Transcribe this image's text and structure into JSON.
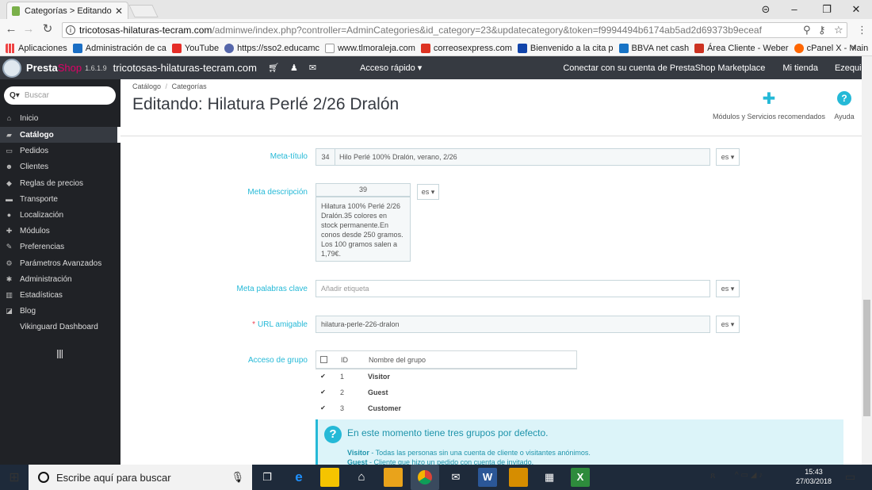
{
  "browser": {
    "tab_title": "Categorías > Editando: H",
    "tab_close": "✕",
    "url_host": "tricotosas-hilaturas-tecram.com",
    "url_path": "/adminwe/index.php?controller=AdminCategories&id_category=23&updatecategory&token=f9994494b6174ab5ad2d69373b9eceaf",
    "window_controls": [
      "⊝",
      "–",
      "❐",
      "✕"
    ],
    "bookmarks": [
      {
        "label": "Aplicaciones",
        "color": "#e44"
      },
      {
        "label": "Administración de ca",
        "color": "#1a6ec4"
      },
      {
        "label": "YouTube",
        "color": "#e52d27"
      },
      {
        "label": "https://sso2.educamc",
        "color": "#56a"
      },
      {
        "label": "www.tlmoraleja.com",
        "color": "#999"
      },
      {
        "label": "correosexpress.com",
        "color": "#d32"
      },
      {
        "label": "Bienvenido a la cita p",
        "color": "#14a"
      },
      {
        "label": "BBVA net cash",
        "color": "#1773c5"
      },
      {
        "label": "Área Cliente - Weber",
        "color": "#c32"
      },
      {
        "label": "cPanel X - Main",
        "color": "#f60"
      }
    ]
  },
  "header": {
    "brand_presta": "Presta",
    "brand_shop": "Shop",
    "version": "1.6.1.9",
    "shop_host": "tricotosas-hilaturas-tecram.com",
    "quick_access": "Acceso rápido ▾",
    "marketplace": "Conectar con su cuenta de PrestaShop Marketplace",
    "my_shop": "Mi tienda",
    "user": "Ezequiel Golderos ▾"
  },
  "sidebar": {
    "search_placeholder": "Buscar",
    "items": [
      {
        "label": "Inicio",
        "icon": "home-icon",
        "glyph": "⌂"
      },
      {
        "label": "Catálogo",
        "icon": "book-icon",
        "glyph": "▰"
      },
      {
        "label": "Pedidos",
        "icon": "card-icon",
        "glyph": "▭"
      },
      {
        "label": "Clientes",
        "icon": "users-icon",
        "glyph": "☻"
      },
      {
        "label": "Reglas de precios",
        "icon": "tags-icon",
        "glyph": "◆"
      },
      {
        "label": "Transporte",
        "icon": "truck-icon",
        "glyph": "▬"
      },
      {
        "label": "Localización",
        "icon": "globe-icon",
        "glyph": "●"
      },
      {
        "label": "Módulos",
        "icon": "puzzle-icon",
        "glyph": "✚"
      },
      {
        "label": "Preferencias",
        "icon": "wrench-icon",
        "glyph": "✎"
      },
      {
        "label": "Parámetros Avanzados",
        "icon": "cogs-icon",
        "glyph": "⚙"
      },
      {
        "label": "Administración",
        "icon": "cog-icon",
        "glyph": "✱"
      },
      {
        "label": "Estadísticas",
        "icon": "chart-icon",
        "glyph": "▥"
      },
      {
        "label": "Blog",
        "icon": "pencil-icon",
        "glyph": "◪"
      },
      {
        "label": "Vikinguard Dashboard",
        "icon": "",
        "glyph": ""
      }
    ]
  },
  "page": {
    "breadcrumb": [
      "Catálogo",
      "/",
      "Categorías"
    ],
    "title": "Editando: Hilatura Perlé 2/26 Dralón",
    "modules_label": "Módulos y Servicios recomendados",
    "help_label": "Ayuda"
  },
  "form": {
    "meta_title": {
      "label": "Meta-título",
      "counter": "34",
      "value": "Hilo Perlé 100% Dralón, verano, 2/26",
      "lang": "es ▾"
    },
    "meta_desc": {
      "label": "Meta descripción",
      "counter": "39",
      "value": "Hilatura 100% Perlé 2/26 Dralón.35  colores en stock permanente.En conos desde 250 gramos. Los 100 gramos salen a 1,79€.",
      "lang": "es ▾"
    },
    "meta_keywords": {
      "label": "Meta palabras clave",
      "placeholder": "Añadir etiqueta",
      "lang": "es ▾"
    },
    "friendly_url": {
      "required": "*",
      "label": "URL amigable",
      "value": "hilatura-perle-226-dralon",
      "lang": "es ▾"
    },
    "group_access": {
      "label": "Acceso de grupo",
      "col_id": "ID",
      "col_name": "Nombre del grupo",
      "rows": [
        {
          "id": "1",
          "name": "Visitor",
          "checked": "✔"
        },
        {
          "id": "2",
          "name": "Guest",
          "checked": "✔"
        },
        {
          "id": "3",
          "name": "Customer",
          "checked": "✔"
        }
      ]
    },
    "alert": {
      "title": "En este momento tiene tres grupos por defecto.",
      "lines": [
        {
          "b": "Visitor",
          "t": " - Todas las personas sin una cuenta de cliente o visitantes anónimos."
        },
        {
          "b": "Guest",
          "t": " - Cliente que hizo un pedido con cuenta de invitado."
        }
      ]
    }
  },
  "taskbar": {
    "search_placeholder": "Escribe aquí para buscar",
    "time": "15:43",
    "date": "27/03/2018"
  }
}
